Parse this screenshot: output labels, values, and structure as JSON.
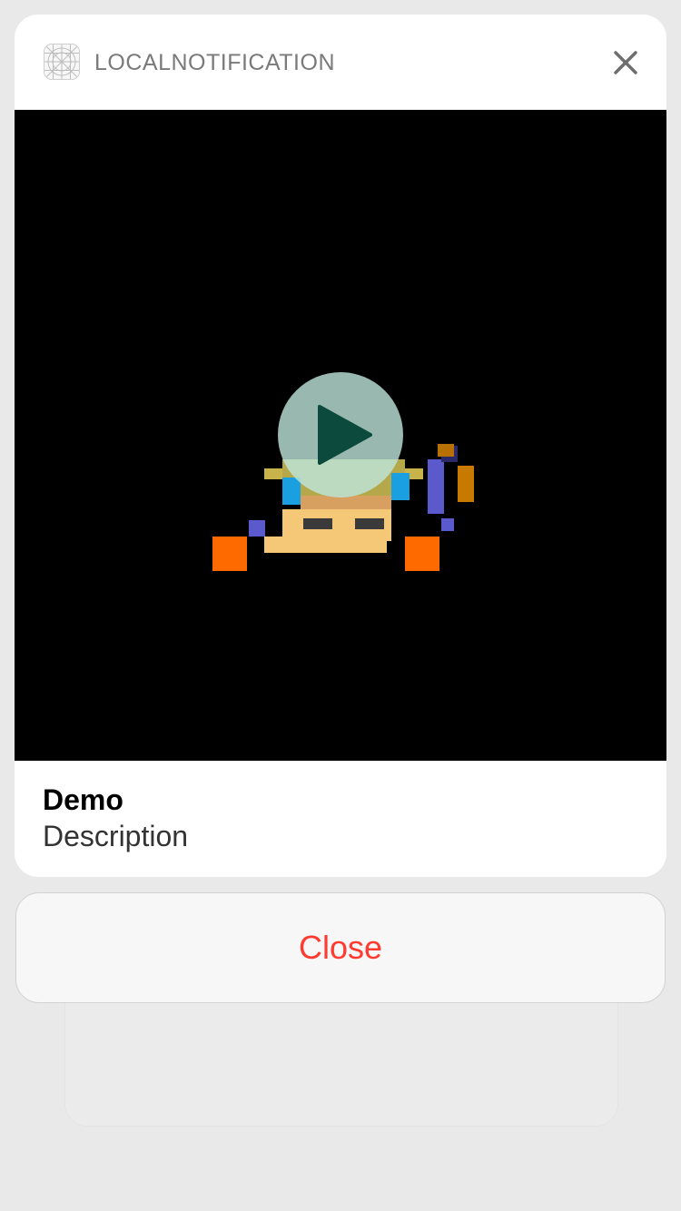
{
  "notification": {
    "app_name": "LOCALNOTIFICATION",
    "app_icon": "app-grid-icon",
    "close_icon": "close-icon",
    "title": "Demo",
    "description": "Description"
  },
  "media": {
    "type": "video-thumbnail",
    "play_icon": "play-icon"
  },
  "actions": {
    "close_label": "Close"
  },
  "colors": {
    "background": "#e9e9e9",
    "card": "#ffffff",
    "media_background": "#000000",
    "action_text": "#ff3b30",
    "play_button": "#bee6dc",
    "play_triangle": "#0b4a3c"
  }
}
